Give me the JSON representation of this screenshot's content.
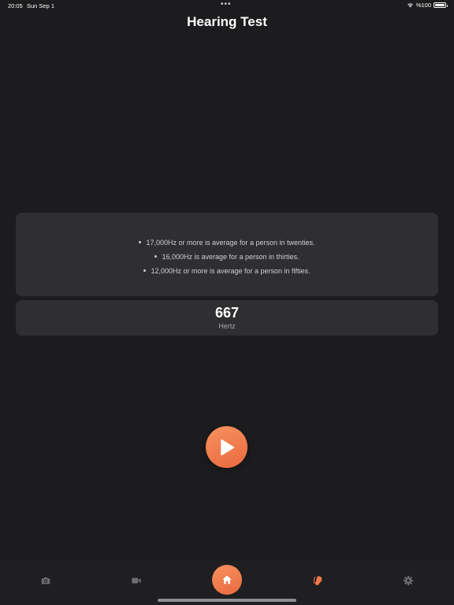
{
  "status_bar": {
    "time": "20:05",
    "date": "Sun Sep 1",
    "battery_label": "%100",
    "battery_level": 1.0
  },
  "header": {
    "title": "Hearing Test"
  },
  "info": {
    "bullets": [
      "17,000Hz or more is average for a person in twenties.",
      "16,000Hz is average for a person in thirties.",
      "12,000Hz or more is average for a person in fifties."
    ]
  },
  "frequency": {
    "value": "667",
    "unit": "Hertz"
  },
  "play": {
    "icon": "play-icon"
  },
  "tabs": [
    {
      "name": "camera",
      "icon": "camera-icon",
      "active": false
    },
    {
      "name": "video",
      "icon": "video-icon",
      "active": false
    },
    {
      "name": "home",
      "icon": "home-icon",
      "active": true
    },
    {
      "name": "hearing",
      "icon": "ear-icon",
      "active": false
    },
    {
      "name": "settings",
      "icon": "gear-icon",
      "active": false
    }
  ],
  "colors": {
    "background": "#1c1c1e",
    "card": "#2f2f31",
    "accent": "#f0794a",
    "tab_icon": "#6d6d72",
    "hearing_icon": "#f0794a"
  }
}
